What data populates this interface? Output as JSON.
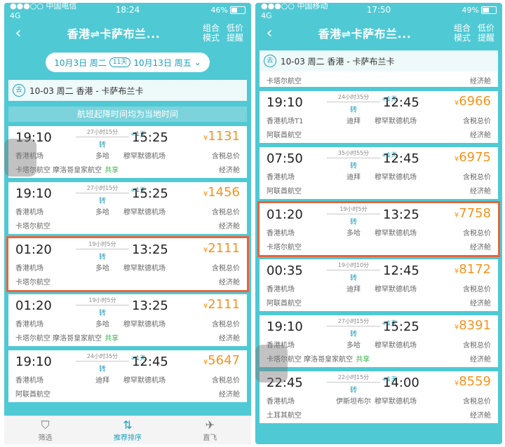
{
  "left": {
    "status": {
      "carrier": "●●●○○ 中国电信  4G",
      "time": "18:24",
      "battery": "46%",
      "battery_level": 0.46
    },
    "nav": {
      "title": "香港⇌卡萨布兰...",
      "btn1": "组合\n模式",
      "btn2": "低价\n提醒"
    },
    "datebar": {
      "depart": "10月3日 周二",
      "duration": "11天",
      "return": "10月13日 周五"
    },
    "segment": {
      "tag": "去",
      "text": "10-03 周二  香港 - 卡萨布兰卡"
    },
    "notice": "航班起降时间均为当地时间",
    "flights": [
      {
        "dep": "19:10",
        "arr": "15:25",
        "dur": "27小时15分",
        "stop": "转",
        "via": "多哈",
        "plus": "+1天",
        "dep_ap": "香港机场",
        "arr_ap": "穆罕默德机场",
        "airline": "卡塔尔航空  摩洛哥皇家航空",
        "share": "共享",
        "price": "1131",
        "tax": "含税总价",
        "cabin": "经济舱"
      },
      {
        "dep": "19:10",
        "arr": "15:25",
        "dur": "27小时15分",
        "stop": "转",
        "via": "多哈",
        "plus": "+1天",
        "dep_ap": "香港机场",
        "arr_ap": "穆罕默德机场",
        "airline": "卡塔尔航空",
        "share": "",
        "price": "1456",
        "tax": "含税总价",
        "cabin": "经济舱"
      },
      {
        "dep": "01:20",
        "arr": "13:25",
        "dur": "19小时5分",
        "stop": "转",
        "via": "多哈",
        "plus": "",
        "dep_ap": "香港机场",
        "arr_ap": "穆罕默德机场",
        "airline": "卡塔尔航空",
        "share": "",
        "price": "2111",
        "tax": "含税总价",
        "cabin": "经济舱"
      },
      {
        "dep": "01:20",
        "arr": "13:25",
        "dur": "19小时5分",
        "stop": "转",
        "via": "多哈",
        "plus": "",
        "dep_ap": "香港机场",
        "arr_ap": "穆罕默德机场",
        "airline": "卡塔尔航空  摩洛哥皇家航空",
        "share": "共享",
        "price": "2111",
        "tax": "含税总价",
        "cabin": "经济舱"
      },
      {
        "dep": "19:10",
        "arr": "12:45",
        "dur": "24小时35分",
        "stop": "转",
        "via": "迪拜",
        "plus": "+1天",
        "dep_ap": "香港机场",
        "arr_ap": "穆罕默德机场",
        "airline": "阿联酋航空",
        "share": "",
        "price": "5647",
        "tax": "含税总价",
        "cabin": "经济舱"
      }
    ],
    "tabs": [
      {
        "icon": "⛉",
        "label": "筛选"
      },
      {
        "icon": "⇅",
        "label": "推荐排序"
      },
      {
        "icon": "✈",
        "label": "直飞"
      }
    ]
  },
  "right": {
    "status": {
      "carrier": "●●●○○ 中国移动  4G",
      "time": "17:50",
      "battery": "49%",
      "battery_level": 0.49
    },
    "nav": {
      "title": "香港⇌卡萨布兰...",
      "btn1": "组合\n模式",
      "btn2": "低价\n提醒"
    },
    "segment": {
      "tag": "去",
      "text": "10-03 周二  香港 - 卡萨布兰卡"
    },
    "partial": {
      "airline": "卡塔尔航空",
      "cabin": "经济舱"
    },
    "flights": [
      {
        "dep": "19:10",
        "arr": "12:45",
        "dur": "24小时35分",
        "stop": "转",
        "via": "迪拜",
        "plus": "+1天",
        "dep_ap": "香港机场T1",
        "arr_ap": "穆罕默德机场",
        "airline": "阿联酋航空",
        "share": "",
        "price": "6966",
        "tax": "含税总价",
        "cabin": "经济舱"
      },
      {
        "dep": "07:50",
        "arr": "12:45",
        "dur": "35小时55分",
        "stop": "转",
        "via": "迪拜",
        "plus": "+1天",
        "dep_ap": "香港机场",
        "arr_ap": "穆罕默德机场",
        "airline": "阿联酋航空",
        "share": "",
        "price": "6975",
        "tax": "含税总价",
        "cabin": "经济舱"
      },
      {
        "dep": "01:20",
        "arr": "13:25",
        "dur": "19小时5分",
        "stop": "转",
        "via": "多哈",
        "plus": "",
        "dep_ap": "香港机场",
        "arr_ap": "穆罕默德机场",
        "airline": "卡塔尔航空",
        "share": "",
        "price": "7758",
        "tax": "含税总价",
        "cabin": "经济舱"
      },
      {
        "dep": "00:35",
        "arr": "12:45",
        "dur": "19小时10分",
        "stop": "转",
        "via": "迪拜",
        "plus": "",
        "dep_ap": "香港机场",
        "arr_ap": "穆罕默德机场",
        "airline": "阿联酋航空",
        "share": "",
        "price": "8172",
        "tax": "含税总价",
        "cabin": "经济舱"
      },
      {
        "dep": "19:10",
        "arr": "15:25",
        "dur": "27小时15分",
        "stop": "转",
        "via": "多哈",
        "plus": "+1天",
        "dep_ap": "香港机场",
        "arr_ap": "穆罕默德机场",
        "airline": "卡塔尔航空  摩洛哥皇家航空",
        "share": "共享",
        "price": "8391",
        "tax": "含税总价",
        "cabin": "经济舱"
      },
      {
        "dep": "22:45",
        "arr": "14:00",
        "dur": "22小时15分",
        "stop": "转",
        "via": "伊斯坦布尔",
        "plus": "+1天",
        "dep_ap": "香港机场",
        "arr_ap": "穆罕默德机场",
        "airline": "土耳其航空",
        "share": "",
        "price": "8559",
        "tax": "含税总价",
        "cabin": "经济舱"
      }
    ]
  },
  "currency": "¥"
}
